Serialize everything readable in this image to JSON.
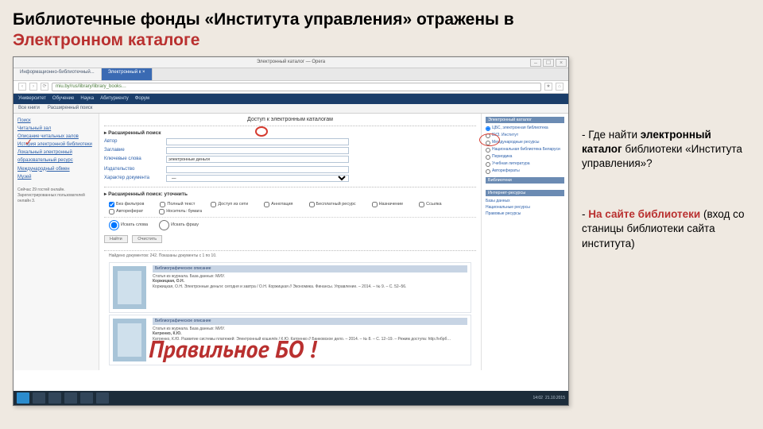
{
  "title": {
    "line1": "Библиотечные фонды «Института управления» отражены в",
    "line2": "Электронном каталоге"
  },
  "annotation": {
    "q_dash": "-",
    "q_text": "Где найти электронный каталог библиотеки «Института управления»?",
    "a_dash": "-",
    "a_lead": "На сайте библиотеки",
    "a_rest": " (вход со станицы библиотеки сайта института)"
  },
  "overlay": "Правильное БО !",
  "browser": {
    "window_title": "Электронный каталог — Opera",
    "tabs": [
      "Информационно-библиотечный...",
      "Электронный  к ×"
    ],
    "url": "miu.by/rus/library/library_books…",
    "navmenu": [
      "Университет",
      "Обучение",
      "Наука",
      "Абитуриенту",
      "Форум"
    ],
    "breadcrumb": [
      "Все книги",
      "Расширенный поиск"
    ]
  },
  "sidebar": {
    "items": [
      "Поиск",
      "Читальный зал",
      "Описание читальных залов",
      "История электронной библиотеки",
      "Локальный электронный образовательный ресурс",
      "Международный обмен",
      "Музей"
    ],
    "note": "Сейчас 29 гостей онлайн. Зарегистрированных пользователей онлайн 3."
  },
  "main": {
    "caption": "Доступ к электронным каталогам",
    "sec1": "Расширенный поиск",
    "fields": {
      "author": "Автор",
      "title": "Заглавие",
      "keywords": "Ключевые слова",
      "keywords_val": "электронные деньги",
      "publisher": "Издательство",
      "bbk": "Характер документа",
      "sel1": "—"
    },
    "sec2": "Расширенный поиск: уточнить",
    "checks": [
      "Без фильтров",
      "Полный текст",
      "Доступ из сети",
      "Аннотация",
      "Бесплатный ресурс",
      "Назначение",
      "Ссылка",
      "Автореферат",
      "Носитель: бумага"
    ],
    "radios": [
      "Искать слова",
      "Искать фразу"
    ],
    "btns": [
      "Найти",
      "Очистить"
    ],
    "results_text": "Найдено документов: 242. Показаны документы с 1 по 10.",
    "card_bar": "Библиографическое описание",
    "card_line1": "Статья из журнала. База данных: МИУ.",
    "card_line2a": "Коржицкая, О.Н.",
    "card_body_a": "Коржицкая, О.Н. Электронные деньги: сегодня и завтра / О.Н. Коржицкая // Экономика. Финансы. Управление. – 2014. – № 9. – С. 52–56.",
    "card_line2b": "Катренко, К.Ю.",
    "card_body_b": "Катренко, К.Ю. Развитие системы платежей: Электронный кошелёк / К.Ю. Катренко // Банковское дело. – 2014. – № 8. – С. 12–19. – Режим доступа: http://нбрб…"
  },
  "rightbox": {
    "hdr1": "Электронный каталог",
    "items": [
      "ЦБС, электронная библиотека",
      "ВУЗ. Институт",
      "Международные ресурсы",
      "Национальная библиотека Беларуси",
      "Периодика",
      "Учебная литература",
      "Авторефераты"
    ],
    "hdr2": "Библиотеки",
    "hdr3": "Интернет-ресурсы",
    "items3": [
      "Базы данных",
      "Национальные ресурсы",
      "Правовые ресурсы"
    ]
  },
  "taskbar": {
    "time": "14:02",
    "date": "21.10.2015"
  }
}
